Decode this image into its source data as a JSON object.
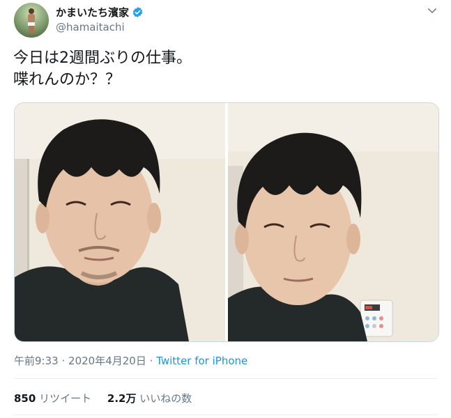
{
  "author": {
    "display_name": "かまいたち濱家",
    "handle": "@hamaitachi",
    "avatar_icon": "avatar-photo",
    "verified_icon": "verified-badge-icon",
    "verified_color": "#1da1f2"
  },
  "menu_icon": "chevron-down-icon",
  "tweet": {
    "lines": [
      "今日は2週間ぶりの仕事。",
      "喋れんのか？？"
    ]
  },
  "media": {
    "photos": [
      "selfie-photo-1",
      "selfie-photo-2"
    ]
  },
  "meta": {
    "time": "午前9:33",
    "separator1": "·",
    "date": "2020年4月20日",
    "separator2": "·",
    "source": "Twitter for iPhone"
  },
  "stats": {
    "retweets_count": "850",
    "retweets_label": "リツイート",
    "likes_count": "2.2万",
    "likes_label": "いいねの数"
  },
  "colors": {
    "text": "#14171a",
    "secondary": "#657786",
    "link": "#1b95e0",
    "divider": "#e6ecf0"
  }
}
